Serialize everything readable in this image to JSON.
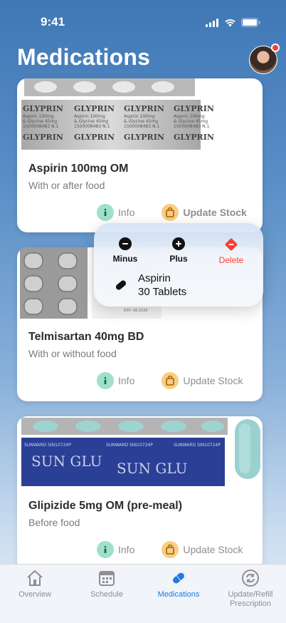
{
  "status": {
    "time": "9:41"
  },
  "header": {
    "title": "Medications"
  },
  "medications": [
    {
      "name": "Aspirin 100mg OM",
      "note": "With or after food",
      "info_label": "Info",
      "stock_label": "Update Stock"
    },
    {
      "name": "Telmisartan 40mg BD",
      "note": "With or without food",
      "info_label": "Info",
      "stock_label": "Update Stock"
    },
    {
      "name": "Glipizide 5mg OM (pre-meal)",
      "note": "Before food",
      "info_label": "Info",
      "stock_label": "Update Stock"
    }
  ],
  "blister_text": {
    "brand": "GLYPRIN",
    "line1": "Aspirin 100mg",
    "line2": "& Glycine 45mg",
    "line3": "1500008483 N.1",
    "sun_brand": "SUN GLU",
    "sun_code": "SUNWARD SIN10724P"
  },
  "popup": {
    "minus_label": "Minus",
    "plus_label": "Plus",
    "delete_label": "Delete",
    "item_name": "Aspirin",
    "item_count": "30 Tablets"
  },
  "tabs": [
    {
      "label": "Overview",
      "icon": "house-icon"
    },
    {
      "label": "Schedule",
      "icon": "calendar-icon"
    },
    {
      "label": "Medications",
      "icon": "pill-icon"
    },
    {
      "label": "Update/Refill Prescription",
      "icon": "refresh-icon"
    }
  ],
  "colors": {
    "accent": "#1f7ae6",
    "danger": "#ff3b30",
    "info_green": "#9fe0cc",
    "stock_orange": "#f8cd84"
  }
}
